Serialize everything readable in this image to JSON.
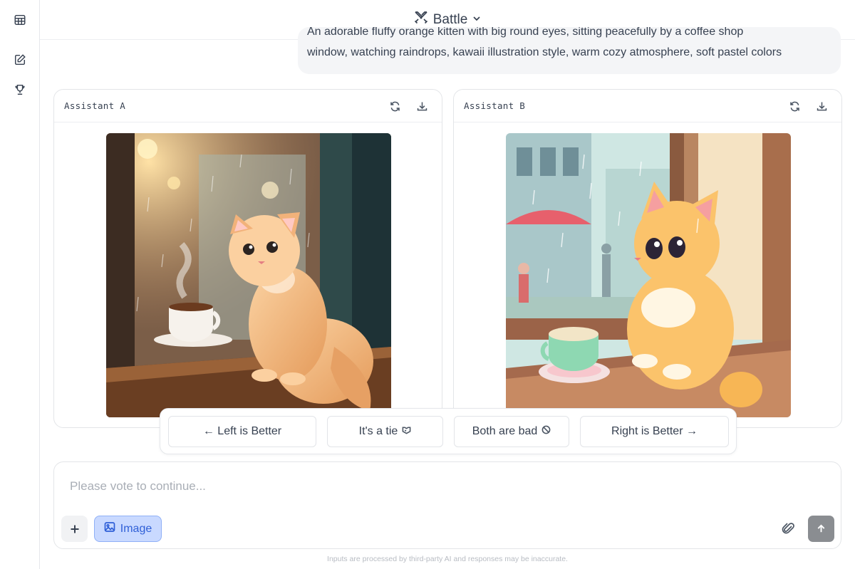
{
  "header": {
    "mode_label": "Battle"
  },
  "prompt": {
    "line1": "An adorable fluffy orange kitten with big round eyes, sitting peacefully by a coffee shop",
    "line2": "window, watching raindrops, kawaii illustration style, warm cozy atmosphere, soft pastel colors"
  },
  "panels": [
    {
      "title": "Assistant A",
      "image_desc": "watercolor-kitten-by-cafe-window"
    },
    {
      "title": "Assistant B",
      "image_desc": "cartoon-kitten-by-rainy-window"
    }
  ],
  "vote": {
    "left": "← Left is Better",
    "tie": "It's a tie",
    "bad": "Both are bad",
    "right": "Right is Better →"
  },
  "composer": {
    "placeholder": "Please vote to continue...",
    "image_label": "Image"
  },
  "footer": {
    "disclaimer": "Inputs are processed by third-party AI and responses may be inaccurate."
  },
  "icons": {
    "sidebar": [
      "table-icon",
      "edit-icon",
      "trophy-icon"
    ],
    "panel": [
      "refresh-icon",
      "download-icon"
    ]
  },
  "colors": {
    "accent": "#2f5fd7",
    "accent_bg": "#c9d9ff",
    "send": "#8a8d91"
  }
}
